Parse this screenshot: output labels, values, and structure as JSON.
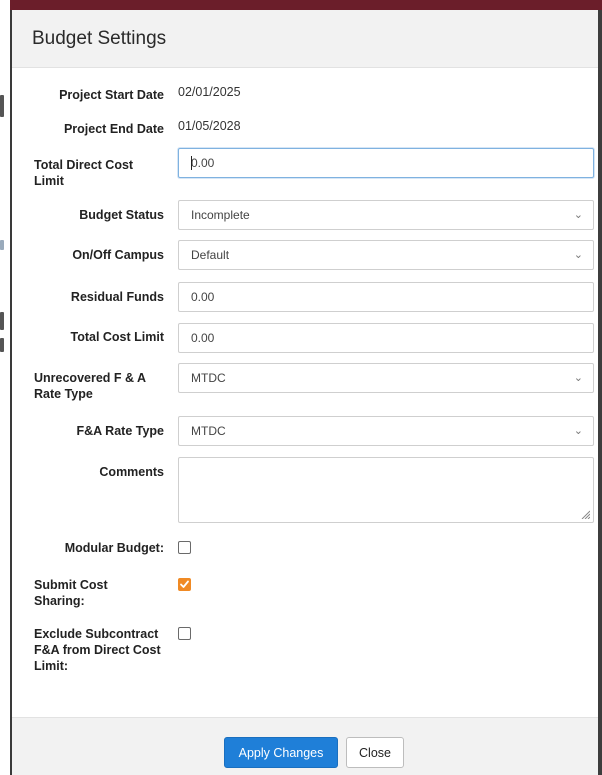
{
  "modal": {
    "title": "Budget Settings"
  },
  "fields": {
    "project_start_date": {
      "label": "Project Start Date",
      "value": "02/01/2025"
    },
    "project_end_date": {
      "label": "Project End Date",
      "value": "01/05/2028"
    },
    "total_direct_cost_limit": {
      "label": "Total Direct Cost Limit",
      "value": "0.00"
    },
    "budget_status": {
      "label": "Budget Status",
      "value": "Incomplete"
    },
    "on_off_campus": {
      "label": "On/Off Campus",
      "value": "Default"
    },
    "residual_funds": {
      "label": "Residual Funds",
      "value": "0.00"
    },
    "total_cost_limit": {
      "label": "Total Cost Limit",
      "value": "0.00"
    },
    "unrecovered_fa_rate_type": {
      "label": "Unrecovered F & A Rate Type",
      "value": "MTDC"
    },
    "fa_rate_type": {
      "label": "F&A Rate Type",
      "value": "MTDC"
    },
    "comments": {
      "label": "Comments",
      "value": ""
    },
    "modular_budget": {
      "label": "Modular Budget:",
      "checked": false
    },
    "submit_cost_sharing": {
      "label": "Submit Cost Sharing:",
      "checked": true
    },
    "exclude_subcontract": {
      "label": "Exclude Subcontract F&A from Direct Cost Limit:",
      "checked": false
    }
  },
  "icons": {
    "select_chevron": "chevron-down-icon",
    "checkbox_check": "check-icon",
    "resize_grip": "resize-grip-icon"
  },
  "colors": {
    "primary_button": "#1f7fd8",
    "checkbox_checked": "#f08a24",
    "focus_border": "#7fb2e0"
  },
  "footer": {
    "apply_label": "Apply Changes",
    "close_label": "Close"
  }
}
